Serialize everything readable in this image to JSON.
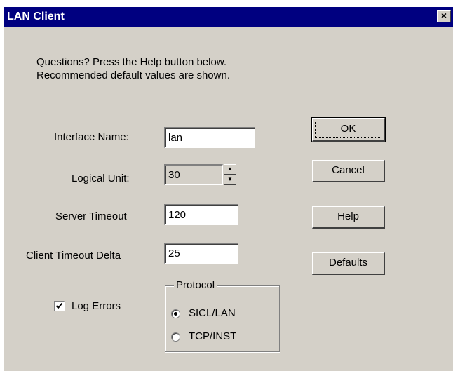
{
  "window": {
    "title": "LAN Client",
    "close_label": "×"
  },
  "intro": {
    "line1": "Questions?  Press the Help button below.",
    "line2": "Recommended default values are shown."
  },
  "fields": {
    "interface_name": {
      "label": "Interface Name:",
      "value": "lan"
    },
    "logical_unit": {
      "label": "Logical Unit:",
      "value": "30"
    },
    "server_timeout": {
      "label": "Server Timeout",
      "value": "120"
    },
    "client_timeout_delta": {
      "label": "Client Timeout Delta",
      "value": "25"
    }
  },
  "buttons": {
    "ok": "OK",
    "cancel": "Cancel",
    "help": "Help",
    "defaults": "Defaults"
  },
  "log_errors": {
    "label": "Log Errors",
    "checked": true
  },
  "protocol": {
    "title": "Protocol",
    "options": [
      "SICL/LAN",
      "TCP/INST"
    ],
    "selected": "SICL/LAN"
  }
}
